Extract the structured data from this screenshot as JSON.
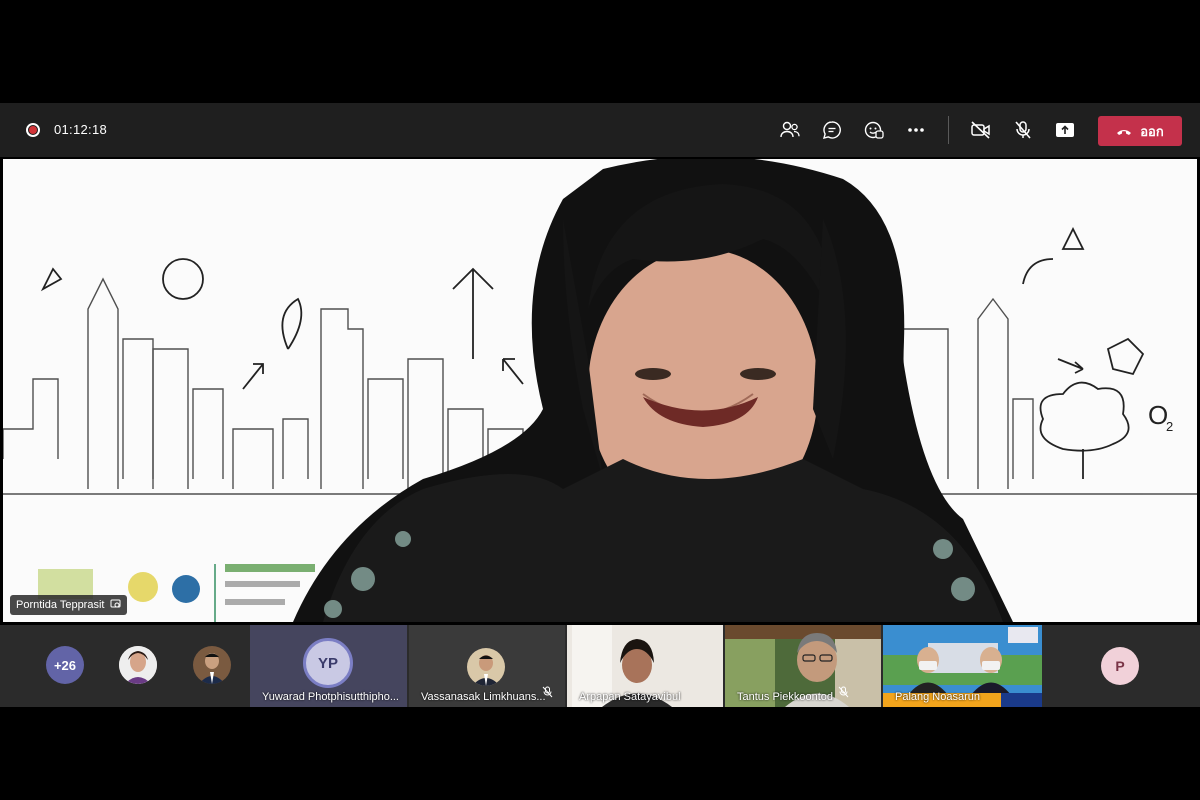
{
  "toolbar": {
    "timer": "01:12:18",
    "icons": [
      "participants-icon",
      "chat-icon",
      "reactions-icon",
      "more-actions-icon",
      "camera-off-icon",
      "mic-off-icon",
      "share-screen-icon"
    ],
    "leave_label": "ออก",
    "leave_color": "#c4314b"
  },
  "main": {
    "speaker_name": "Porntida Tepprasit"
  },
  "strip": {
    "overflow_count": "+26",
    "tiles": [
      {
        "initials": "YP",
        "name": "Yuwarad Photphisutthipho..."
      },
      {
        "name": "Vassanasak Limkhuans..."
      },
      {
        "name": "Arpapan Satayavibul"
      },
      {
        "name": "Tantus Piekkoontod"
      },
      {
        "name": "Palang Noasarun"
      }
    ],
    "last_avatar_initial": "P",
    "accent": "#6264a7"
  }
}
